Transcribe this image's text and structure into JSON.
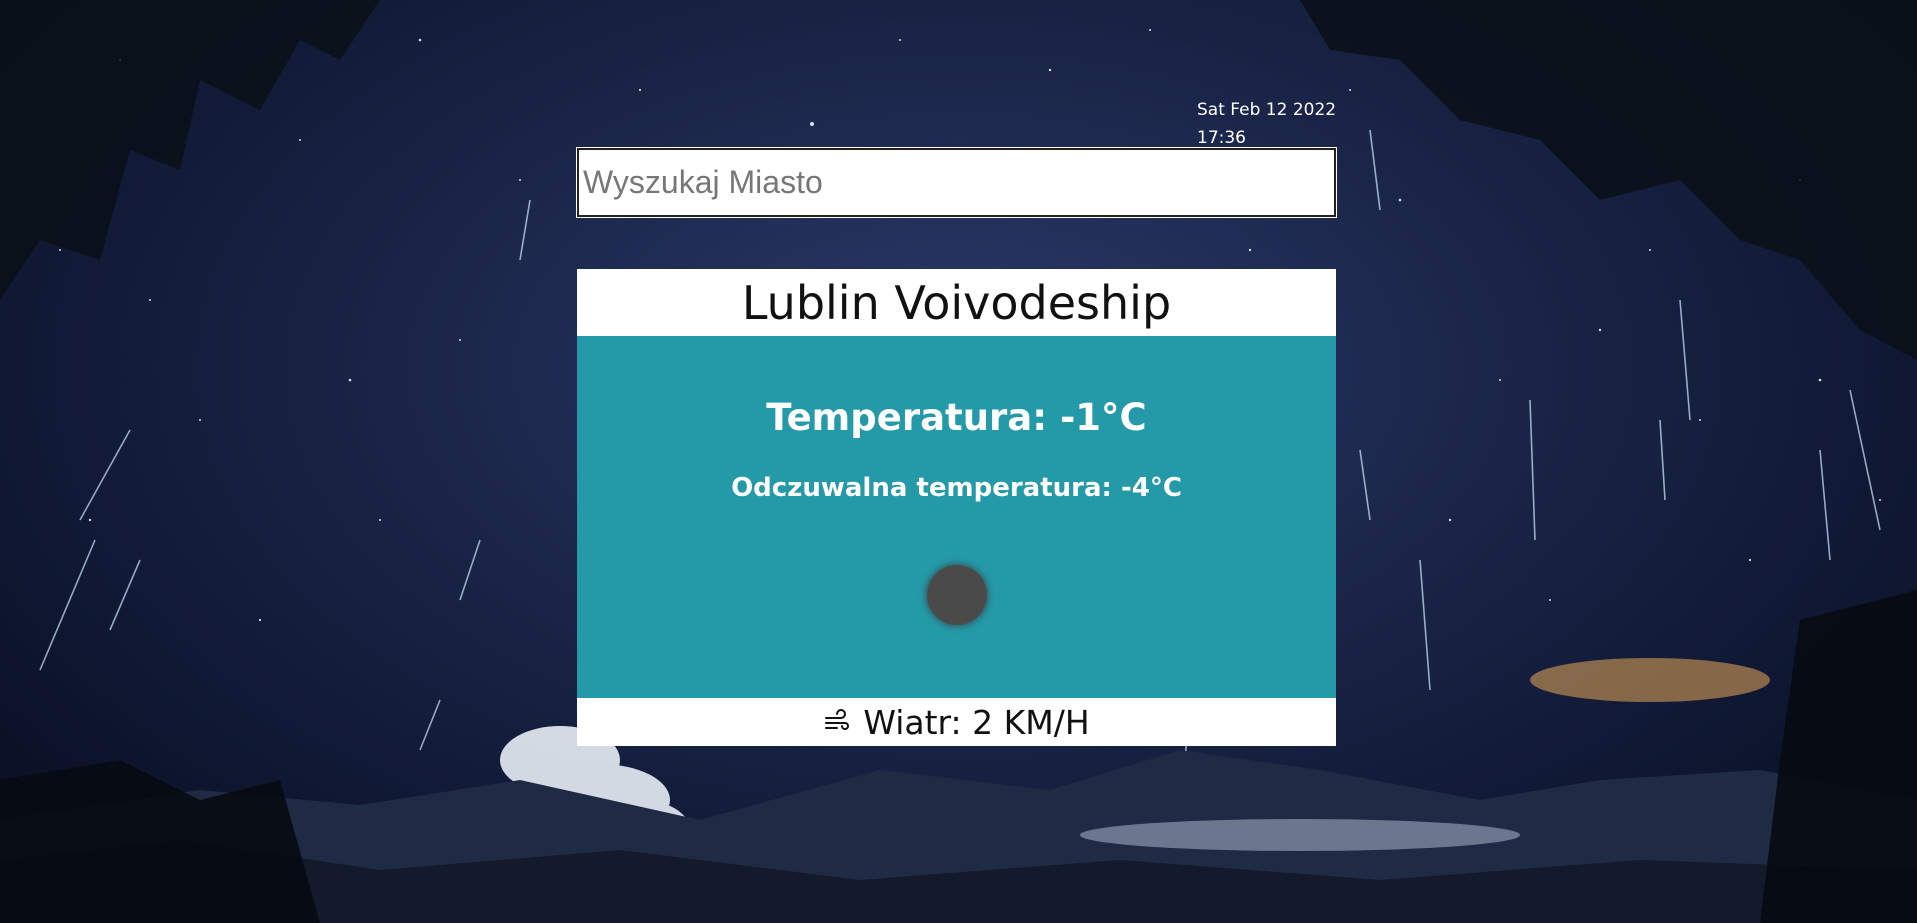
{
  "datetime": {
    "date": "Sat Feb 12 2022",
    "time": "17:36"
  },
  "search": {
    "placeholder": "Wyszukaj Miasto"
  },
  "weather": {
    "location": "Lublin Voivodeship",
    "temperature": "Temperatura: -1°C",
    "feels_like": "Odczuwalna temperatura: -4°C",
    "condition_icon": "dark-cloud-icon",
    "wind": "Wiatr: 2 KM/H",
    "wind_icon": "wind-icon"
  },
  "colors": {
    "card_body": "#2499a8",
    "card_header": "#ffffff",
    "sky": "#1a2548"
  }
}
